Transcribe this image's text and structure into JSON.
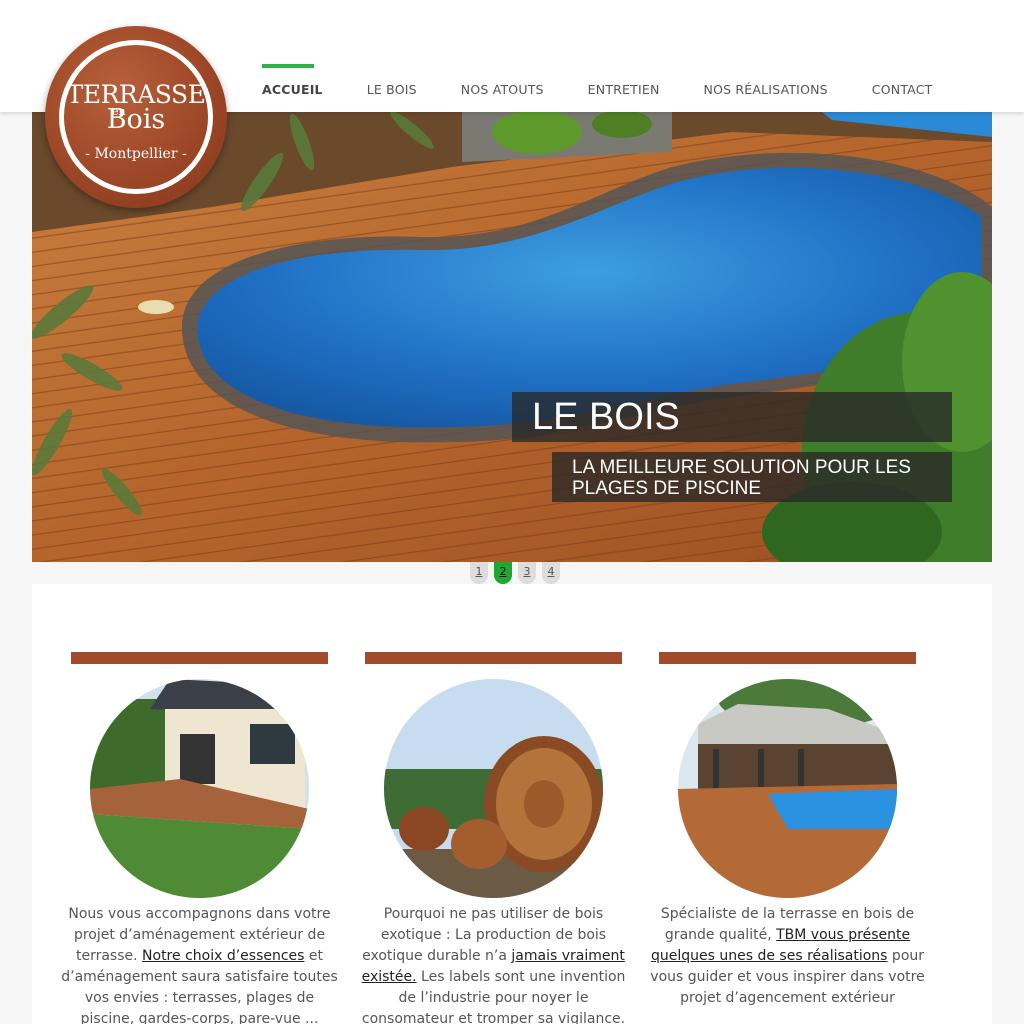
{
  "logo": {
    "line1": "TERRASSE",
    "en": "en",
    "line2": "Bois",
    "line3": "- Montpellier -"
  },
  "nav": [
    {
      "label": "ACCUEIL"
    },
    {
      "label": "LE BOIS"
    },
    {
      "label": "NOS ATOUTS"
    },
    {
      "label": "ENTRETIEN"
    },
    {
      "label": "NOS RÉALISATIONS"
    },
    {
      "label": "CONTACT"
    }
  ],
  "slider": {
    "title": "LE BOIS",
    "subtitle": "LA MEILLEURE SOLUTION POUR LES PLAGES DE PISCINE",
    "pages": [
      "1",
      "2",
      "3",
      "4"
    ],
    "active_page": "2"
  },
  "columns": [
    {
      "text_before": "Nous vous accompagnons dans votre projet d’aménagement extérieur de terrasse. ",
      "link": "Notre choix d’essences",
      "text_after": " et d’aménagement saura satisfaire toutes vos envies : terrasses, plages de piscine, gardes-corps, pare-vue ..."
    },
    {
      "text_before": "Pourquoi ne pas utiliser de bois exotique : La production de bois exotique durable n’a ",
      "link": "jamais vraiment existée.",
      "text_after": " Les labels sont une invention de l’industrie pour noyer le consomateur et tromper sa vigilance."
    },
    {
      "text_before": "Spécialiste de la terrasse en bois de grande qualité, ",
      "link": "TBM vous présente quelques unes de ses réalisations",
      "text_after": " pour vous guider et vous inspirer dans votre projet d’agencement extérieur"
    }
  ],
  "colors": {
    "accent": "#2db34a",
    "brand": "#a34a2a",
    "pager_active": "#1da82f"
  }
}
